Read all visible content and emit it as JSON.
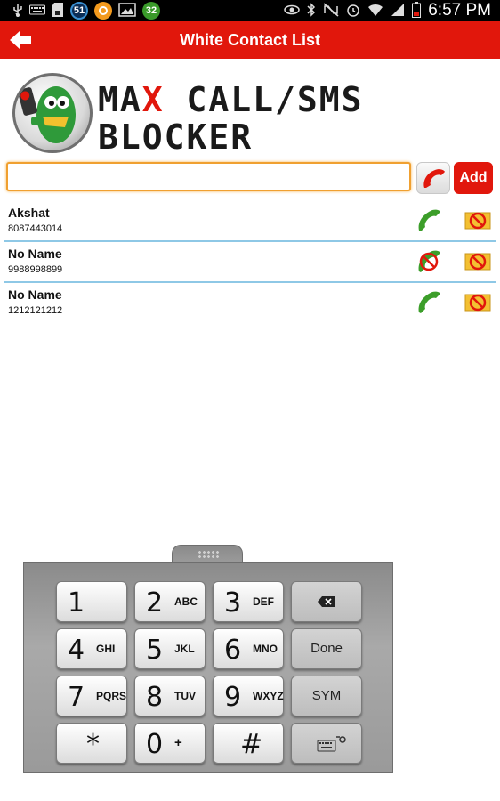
{
  "status_bar": {
    "time": "6:57 PM",
    "badges": [
      "51",
      "32"
    ],
    "icons_left": [
      "usb-icon",
      "keyboard-icon",
      "sd-card-icon",
      "notification-51-badge",
      "orange-app-icon",
      "gallery-icon",
      "notification-32-badge"
    ],
    "icons_right": [
      "eye-icon",
      "bluetooth-icon",
      "mute-icon",
      "alarm-icon",
      "wifi-icon",
      "signal-icon",
      "battery-icon"
    ]
  },
  "header": {
    "title": "White Contact List",
    "back_icon": "back-arrow-icon",
    "background": "#e1170c"
  },
  "logo": {
    "line1_a": "MA",
    "line1_x": "X",
    "line1_b": " CALL/SMS",
    "line2": "BLOCKER",
    "accent": "#e1170c"
  },
  "input": {
    "value": "",
    "placeholder": "",
    "add_label": "Add"
  },
  "contacts": [
    {
      "name": "Akshat",
      "number": "8087443014",
      "call_blocked": false
    },
    {
      "name": "No Name",
      "number": "9988998899",
      "call_blocked": true
    },
    {
      "name": "No Name",
      "number": "1212121212",
      "call_blocked": false
    }
  ],
  "keypad": {
    "keys": [
      {
        "digit": "1",
        "letters": ""
      },
      {
        "digit": "2",
        "letters": "ABC"
      },
      {
        "digit": "3",
        "letters": "DEF"
      },
      {
        "digit": "4",
        "letters": "GHI"
      },
      {
        "digit": "5",
        "letters": "JKL"
      },
      {
        "digit": "6",
        "letters": "MNO"
      },
      {
        "digit": "7",
        "letters": "PQRS"
      },
      {
        "digit": "8",
        "letters": "TUV"
      },
      {
        "digit": "9",
        "letters": "WXYZ"
      },
      {
        "digit": "*",
        "letters": ""
      },
      {
        "digit": "0",
        "letters": "+"
      },
      {
        "digit": "#",
        "letters": ""
      }
    ],
    "done_label": "Done",
    "sym_label": "SYM",
    "backspace_icon": "backspace-icon",
    "settings_icon": "keyboard-settings-icon"
  }
}
